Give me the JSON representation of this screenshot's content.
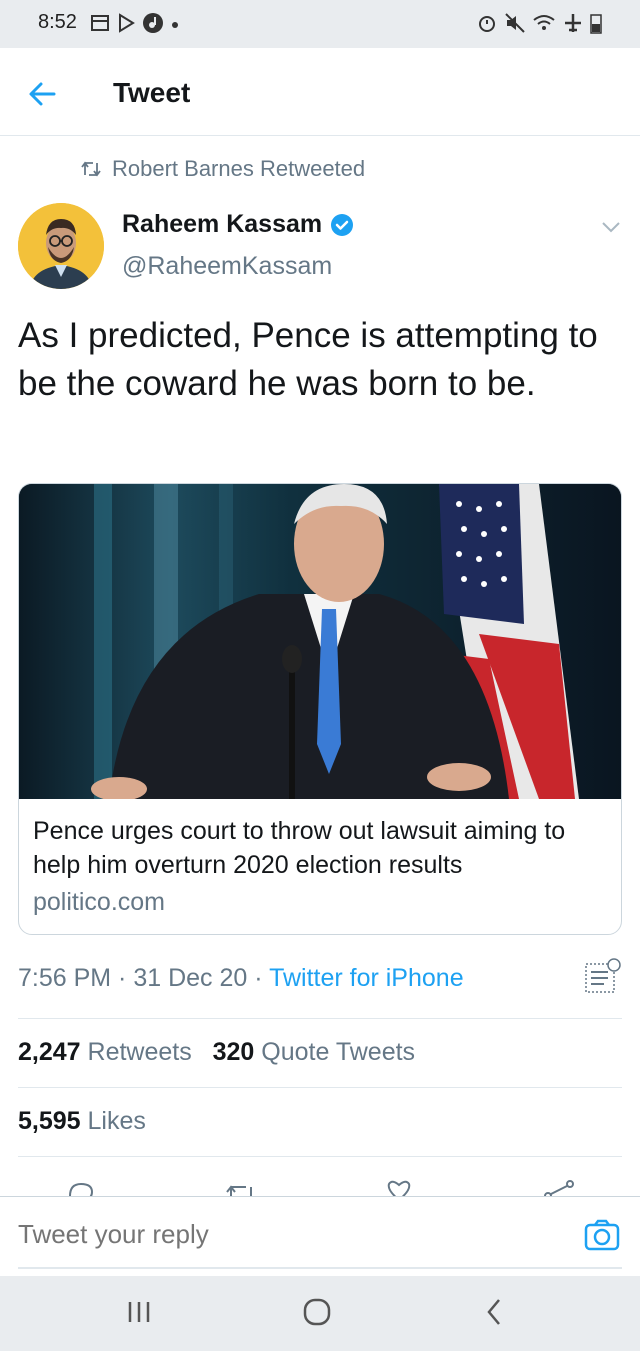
{
  "status_bar": {
    "time": "8:52",
    "left_icons": [
      "calendar-icon",
      "play-store-icon",
      "music-icon",
      "dot-icon"
    ],
    "right_icons": [
      "alarm-icon",
      "mute-icon",
      "wifi-icon",
      "airplane-icon",
      "battery-icon"
    ]
  },
  "app_bar": {
    "title": "Tweet",
    "back_icon": "back-arrow-icon"
  },
  "tweet": {
    "retweeted_by": "Robert Barnes Retweeted",
    "author": {
      "name": "Raheem Kassam",
      "handle": "@RaheemKassam",
      "verified": true
    },
    "text": "As I predicted, Pence is attempting to be the coward he was born to be.",
    "card": {
      "title": "Pence urges court to throw out lawsuit aiming to help him overturn 2020 election results",
      "domain": "politico.com"
    },
    "timestamp": "7:56 PM · 31 Dec 20 · ",
    "source": "Twitter for iPhone",
    "retweets_count": "2,247",
    "retweets_label": "Retweets",
    "quote_count": "320",
    "quote_label": "Quote Tweets",
    "likes_count": "5,595",
    "likes_label": "Likes"
  },
  "reply": {
    "placeholder": "Tweet your reply"
  },
  "colors": {
    "accent": "#1da1f2",
    "secondary_text": "#657786",
    "primary_text": "#14171a",
    "status_bar_bg": "#e9ecef"
  }
}
